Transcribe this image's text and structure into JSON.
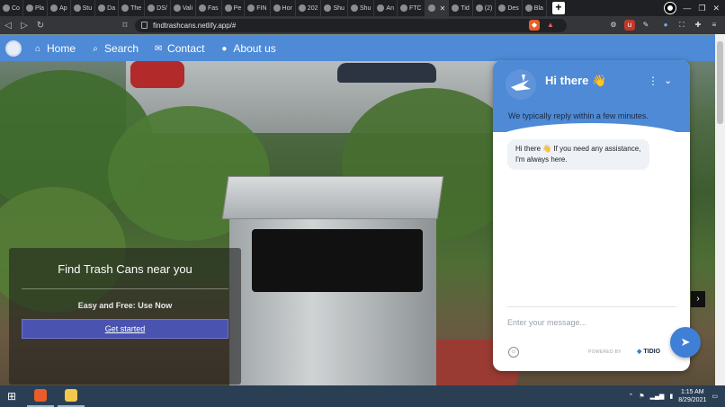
{
  "browser": {
    "tabs": [
      {
        "label": "Co"
      },
      {
        "label": "Pla"
      },
      {
        "label": "Ap"
      },
      {
        "label": "Stu"
      },
      {
        "label": "Da"
      },
      {
        "label": "The"
      },
      {
        "label": "DS/"
      },
      {
        "label": "Vali"
      },
      {
        "label": "Fas"
      },
      {
        "label": "Pe"
      },
      {
        "label": "FIN"
      },
      {
        "label": "Hor"
      },
      {
        "label": "202"
      },
      {
        "label": "Shu"
      },
      {
        "label": "Shu"
      },
      {
        "label": "An"
      },
      {
        "label": "FTC"
      },
      {
        "label": ""
      },
      {
        "label": "Tid"
      },
      {
        "label": "(2)"
      },
      {
        "label": "Des"
      },
      {
        "label": "Bla"
      }
    ],
    "active_tab_index": 17,
    "new_tab_label": "+",
    "url": "findtrashcans.netlify.app/#"
  },
  "site": {
    "nav": {
      "home_label": "Home",
      "search_label": "Search",
      "contact_label": "Contact",
      "about_label": "About us"
    },
    "hero": {
      "title": "Find Trash Cans near you",
      "subtitle": "Easy and Free: Use Now",
      "cta_label": "Get started"
    }
  },
  "chat": {
    "title": "Hi there 👋",
    "subtitle": "We typically reply within a few minutes.",
    "message": "Hi there 👋 If you need any assistance, I'm always here.",
    "input_placeholder": "Enter your message...",
    "powered_by": "POWERED BY",
    "brand": "TIDIO",
    "accent_color": "#4e8ad6"
  },
  "taskbar": {
    "time": "1:15 AM",
    "date": "8/29/2021"
  }
}
